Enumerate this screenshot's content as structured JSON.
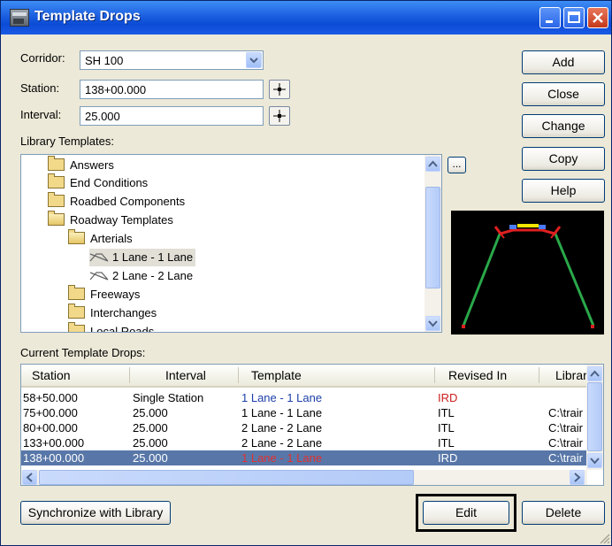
{
  "window": {
    "title": "Template Drops"
  },
  "form": {
    "corridor_label": "Corridor:",
    "corridor_value": "SH 100",
    "station_label": "Station:",
    "station_value": "138+00.000",
    "interval_label": "Interval:",
    "interval_value": "25.000",
    "library_label": "Library Templates:",
    "current_label": "Current Template Drops:"
  },
  "buttons": {
    "add": "Add",
    "close": "Close",
    "change": "Change",
    "copy": "Copy",
    "help": "Help",
    "browse": "...",
    "sync": "Synchronize with Library",
    "edit": "Edit",
    "delete": "Delete"
  },
  "tree": [
    {
      "label": "Answers",
      "type": "folder"
    },
    {
      "label": "End Conditions",
      "type": "folder"
    },
    {
      "label": "Roadbed Components",
      "type": "folder"
    },
    {
      "label": "Roadway Templates",
      "type": "folder-open"
    },
    {
      "label": "Arterials",
      "type": "folder-open"
    },
    {
      "label": "1 Lane - 1 Lane",
      "type": "template",
      "selected": true
    },
    {
      "label": "2 Lane - 2 Lane",
      "type": "template"
    },
    {
      "label": "Freeways",
      "type": "folder"
    },
    {
      "label": "Interchanges",
      "type": "folder"
    },
    {
      "label": "Local Roads",
      "type": "folder"
    }
  ],
  "grid": {
    "columns": [
      "Station",
      "Interval",
      "Template",
      "Revised In",
      "Librar"
    ],
    "rows": [
      {
        "station": "58+50.000",
        "interval": "Single Station",
        "template": "1 Lane - 1 Lane",
        "revised": "IRD",
        "library": ""
      },
      {
        "station": "75+00.000",
        "interval": "25.000",
        "template": "1 Lane - 1 Lane",
        "revised": "ITL",
        "library": "C:\\trair"
      },
      {
        "station": "80+00.000",
        "interval": "25.000",
        "template": "2 Lane - 2 Lane",
        "revised": "ITL",
        "library": "C:\\trair"
      },
      {
        "station": "133+00.000",
        "interval": "25.000",
        "template": "2 Lane - 2 Lane",
        "revised": "ITL",
        "library": "C:\\trair"
      },
      {
        "station": "138+00.000",
        "interval": "25.000",
        "template": "1 Lane - 1 Lane",
        "revised": "IRD",
        "library": "C:\\trair",
        "selected": true
      }
    ]
  },
  "colors": {
    "ird_text": "#cc1f1f",
    "template_blue": "#1d3fa8",
    "selected_row": "#5877a8"
  }
}
